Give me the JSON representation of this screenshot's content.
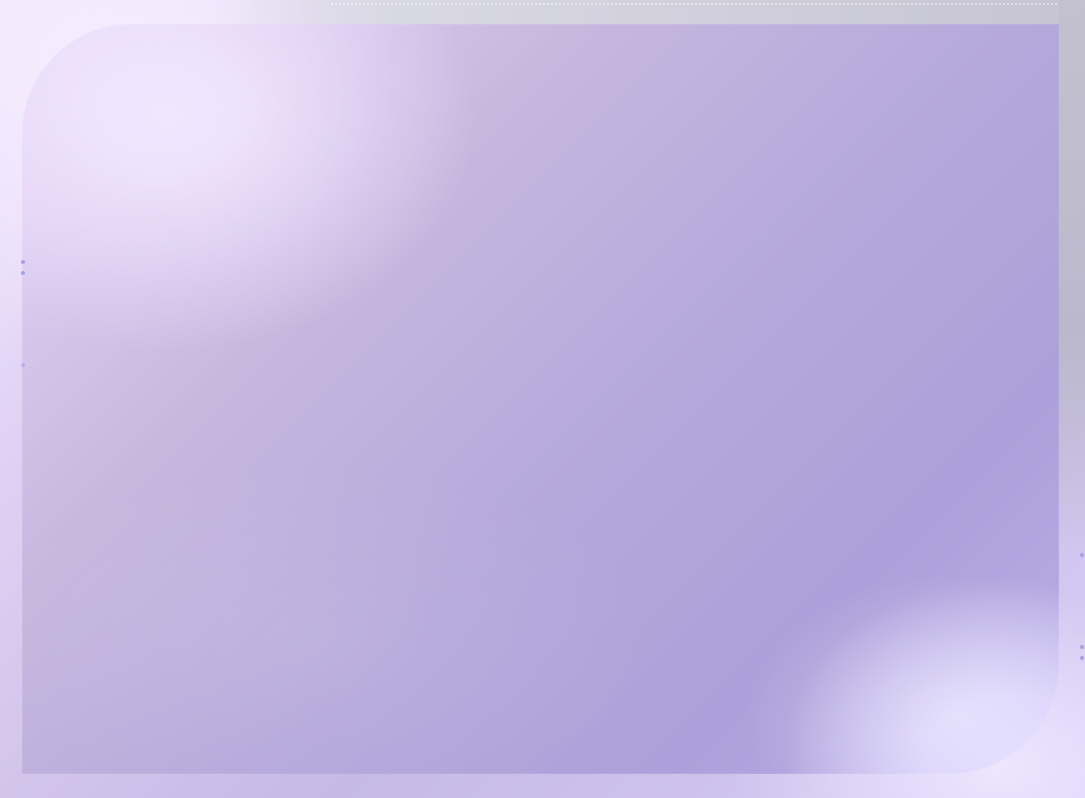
{
  "slide": {
    "title": "",
    "body": ""
  },
  "theme": {
    "background_base": "#d9c9ef",
    "panel_color_start": "#e6d7f7",
    "panel_color_end": "#aca0da",
    "band_color": "#c6c4d2",
    "dot_color": "#9c9ae0"
  },
  "decor": {
    "left_dots": [
      "decor-dot",
      "decor-dot",
      "decor-dot"
    ],
    "right_dots": [
      "decor-dot",
      "decor-dot",
      "decor-dot"
    ]
  }
}
